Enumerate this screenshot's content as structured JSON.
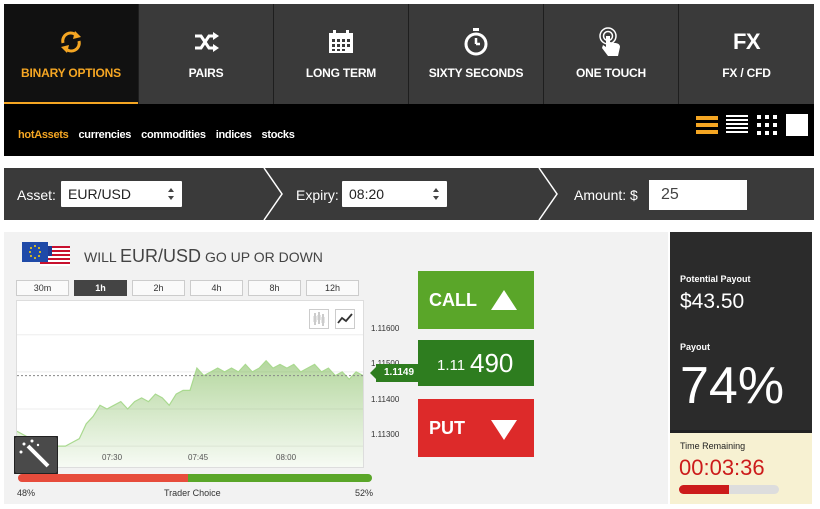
{
  "nav": {
    "tabs": [
      {
        "label": "BINARY OPTIONS",
        "icon": "refresh-arrows-icon",
        "active": true
      },
      {
        "label": "PAIRS",
        "icon": "shuffle-icon",
        "active": false
      },
      {
        "label": "LONG TERM",
        "icon": "calendar-icon",
        "active": false
      },
      {
        "label": "SIXTY SECONDS",
        "icon": "stopwatch-icon",
        "active": false
      },
      {
        "label": "ONE TOUCH",
        "icon": "touch-icon",
        "active": false
      },
      {
        "label": "FX / CFD",
        "icon_text": "FX",
        "active": false
      }
    ]
  },
  "categories": [
    "hotAssets",
    "currencies",
    "commodities",
    "indices",
    "stocks"
  ],
  "active_category": "hotAssets",
  "views": [
    "list-view-icon",
    "compact-list-icon",
    "grid-view-icon",
    "tile-view-icon"
  ],
  "assetbar": {
    "asset_label": "Asset:",
    "asset_value": "EUR/USD",
    "expiry_label": "Expiry:",
    "expiry_value": "08:20",
    "amount_label": "Amount: $",
    "amount_value": "25"
  },
  "question": {
    "prefix": "WILL",
    "asset": "EUR/USD",
    "suffix": "GO UP OR DOWN"
  },
  "timeframes": [
    {
      "label": "30m",
      "active": false
    },
    {
      "label": "1h",
      "active": true
    },
    {
      "label": "2h",
      "active": false
    },
    {
      "label": "4h",
      "active": false
    },
    {
      "label": "8h",
      "active": false
    },
    {
      "label": "12h",
      "active": false
    }
  ],
  "chart_data": {
    "type": "area",
    "y_ticks": [
      "1.11600",
      "1.11500",
      "1.11400",
      "1.11300"
    ],
    "x_ticks": [
      "07:30",
      "07:45",
      "08:00"
    ],
    "ylim": [
      1.1126,
      1.1168
    ],
    "x": [
      0,
      2,
      4,
      6,
      8,
      10,
      12,
      14,
      16,
      18,
      20,
      22,
      24,
      26,
      28,
      30,
      32,
      34,
      36,
      38,
      40,
      42,
      44,
      46,
      48,
      50,
      52,
      54,
      56,
      58,
      60,
      62,
      64,
      66,
      68,
      70,
      72,
      74,
      76,
      78,
      80,
      82,
      84,
      86,
      88,
      90,
      92,
      94,
      96,
      98,
      100
    ],
    "values": [
      1.1134,
      1.1133,
      1.1132,
      1.1131,
      1.1131,
      1.113,
      1.113,
      1.113,
      1.1131,
      1.1132,
      1.1136,
      1.1138,
      1.1141,
      1.114,
      1.1141,
      1.1142,
      1.114,
      1.1142,
      1.1143,
      1.1142,
      1.1144,
      1.1143,
      1.1141,
      1.1144,
      1.1145,
      1.1145,
      1.1151,
      1.1149,
      1.115,
      1.1151,
      1.115,
      1.1151,
      1.115,
      1.1152,
      1.115,
      1.1151,
      1.1153,
      1.1151,
      1.1152,
      1.1151,
      1.1152,
      1.115,
      1.1151,
      1.1152,
      1.115,
      1.1151,
      1.1149,
      1.115,
      1.1148,
      1.115,
      1.1149
    ],
    "current_price": "1.1149",
    "grid": true,
    "series_color": "#5aa629"
  },
  "trader_choice": {
    "label": "Trader Choice",
    "put_pct": 48,
    "call_pct": 52,
    "put_text": "48%",
    "call_text": "52%"
  },
  "actions": {
    "call_label": "CALL",
    "put_label": "PUT",
    "price_prefix": "1.11",
    "price_main": "490"
  },
  "side": {
    "potential_label": "Potential Payout",
    "potential_value": "$43.50",
    "payout_label": "Payout",
    "payout_value": "74%",
    "time_label": "Time Remaining",
    "time_value": "00:03:36",
    "time_progress": 0.5
  },
  "colors": {
    "accent": "#f5a623",
    "call": "#5aa629",
    "put": "#dd2a2a",
    "price": "#2e7d1f"
  }
}
